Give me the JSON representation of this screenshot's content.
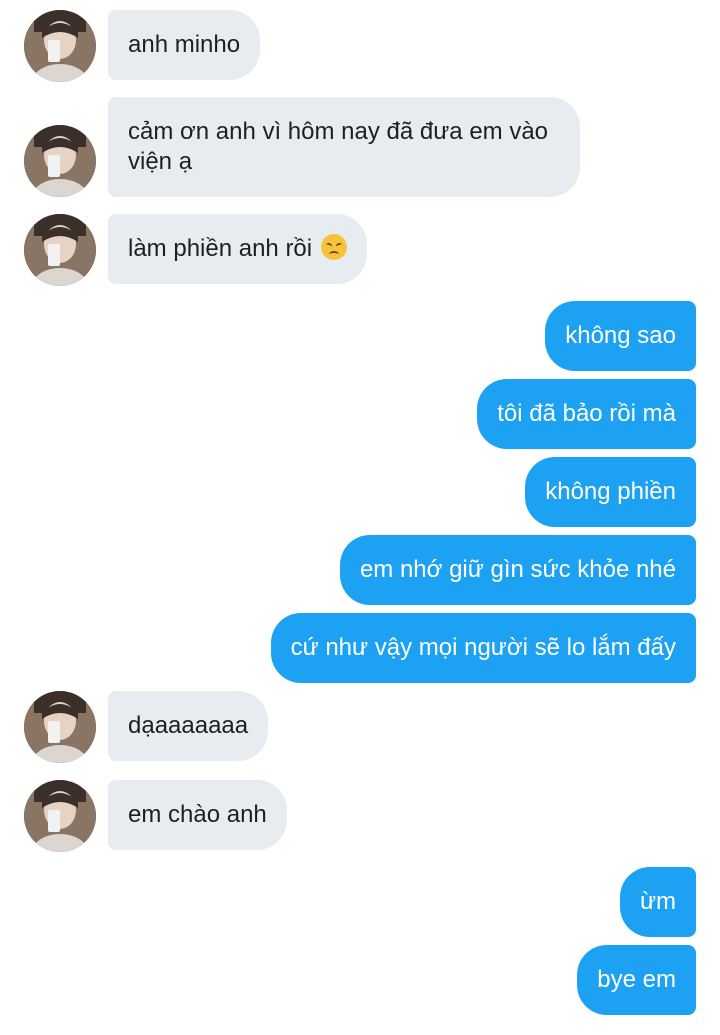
{
  "chat": {
    "contact_avatar": "profile-photo",
    "colors": {
      "incoming_bubble": "#e6ecf0",
      "outgoing_bubble": "#1da1f2",
      "incoming_text": "#1c2022",
      "outgoing_text": "#ffffff"
    },
    "messages": [
      {
        "direction": "incoming",
        "text": "anh minho"
      },
      {
        "direction": "incoming",
        "text": "cảm ơn anh vì hôm nay đã đưa em vào viện ạ"
      },
      {
        "direction": "incoming",
        "text": "làm phiền anh rồi",
        "emoji": "disappointed-face-emoji"
      },
      {
        "direction": "outgoing",
        "text": "không sao"
      },
      {
        "direction": "outgoing",
        "text": "tôi đã bảo rồi mà"
      },
      {
        "direction": "outgoing",
        "text": "không phiền"
      },
      {
        "direction": "outgoing",
        "text": "em nhớ giữ gìn sức khỏe nhé"
      },
      {
        "direction": "outgoing",
        "text": "cứ như vậy mọi người sẽ lo lắm đấy"
      },
      {
        "direction": "incoming",
        "text": "dạaaaaaaa"
      },
      {
        "direction": "incoming",
        "text": "em chào anh"
      },
      {
        "direction": "outgoing",
        "text": "ừm"
      },
      {
        "direction": "outgoing",
        "text": "bye em"
      }
    ]
  }
}
